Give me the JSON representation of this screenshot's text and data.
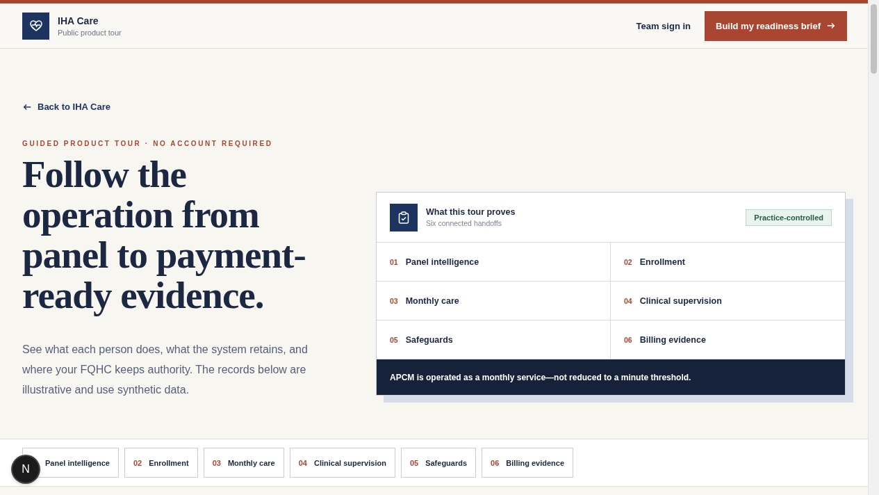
{
  "header": {
    "brand": "IHA Care",
    "subtitle": "Public product tour",
    "sign_in": "Team sign in",
    "cta": "Build my readiness brief"
  },
  "back_link": "Back to IHA Care",
  "eyebrow": "GUIDED PRODUCT TOUR · NO ACCOUNT REQUIRED",
  "headline": "Follow the operation from panel to payment-ready evidence.",
  "intro": "See what each person does, what the system retains, and where your FQHC keeps authority. The records below are illustrative and use synthetic data.",
  "card": {
    "title": "What this tour proves",
    "subtitle": "Six connected handoffs",
    "badge": "Practice-controlled",
    "steps": [
      {
        "number": "01",
        "label": "Panel intelligence"
      },
      {
        "number": "02",
        "label": "Enrollment"
      },
      {
        "number": "03",
        "label": "Monthly care"
      },
      {
        "number": "04",
        "label": "Clinical supervision"
      },
      {
        "number": "05",
        "label": "Safeguards"
      },
      {
        "number": "06",
        "label": "Billing evidence"
      }
    ],
    "footer": "APCM is operated as a monthly service—not reduced to a minute threshold."
  },
  "step_tabs": [
    {
      "label": "Panel intelligence"
    },
    {
      "number": "02",
      "label": "Enrollment"
    },
    {
      "number": "03",
      "label": "Monthly care"
    },
    {
      "number": "04",
      "label": "Clinical supervision"
    },
    {
      "number": "05",
      "label": "Safeguards"
    },
    {
      "number": "06",
      "label": "Billing evidence"
    }
  ],
  "dev_badge": "N"
}
